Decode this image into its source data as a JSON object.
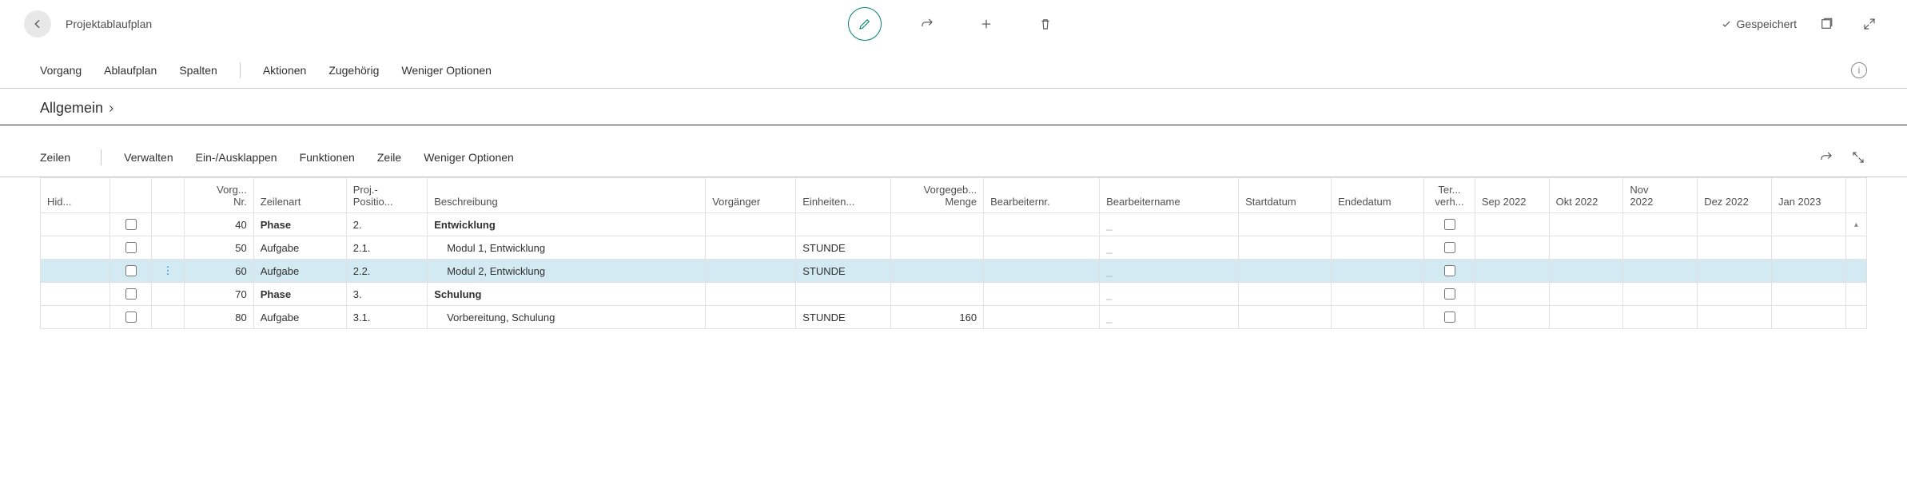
{
  "header": {
    "title": "Projektablaufplan",
    "saved_label": "Gespeichert"
  },
  "menu": {
    "vorgang": "Vorgang",
    "ablaufplan": "Ablaufplan",
    "spalten": "Spalten",
    "aktionen": "Aktionen",
    "zugehoerig": "Zugehörig",
    "weniger_optionen": "Weniger Optionen"
  },
  "section": {
    "title": "Allgemein"
  },
  "lines": {
    "title": "Zeilen",
    "verwalten": "Verwalten",
    "einausklappen": "Ein-/Ausklappen",
    "funktionen": "Funktionen",
    "zeile": "Zeile",
    "weniger_optionen": "Weniger Optionen"
  },
  "columns": {
    "hid": "Hid...",
    "vorg_nr_top": "Vorg...",
    "vorg_nr_bot": "Nr.",
    "zeilenart": "Zeilenart",
    "projpos_top": "Proj.-",
    "projpos_bot": "Positio...",
    "beschreibung": "Beschreibung",
    "vorgaenger": "Vorgänger",
    "einheiten": "Einheiten...",
    "vorgegeb_top": "Vorgegeb...",
    "vorgegeb_bot": "Menge",
    "bearbeiternr": "Bearbeiternr.",
    "bearbeitername": "Bearbeitername",
    "startdatum": "Startdatum",
    "endedatum": "Endedatum",
    "terverh_top": "Ter...",
    "terverh_bot": "verh...",
    "sep2022": "Sep 2022",
    "okt2022": "Okt 2022",
    "nov2022_top": "Nov",
    "nov2022_bot": "2022",
    "dez2022": "Dez 2022",
    "jan2023": "Jan 2023"
  },
  "rows": [
    {
      "vorg_nr": "40",
      "zeilenart": "Phase",
      "zeilenart_bold": true,
      "projpos": "2.",
      "beschreibung": "Entwicklung",
      "besch_bold": true,
      "indent": 0,
      "einheit": "",
      "menge": "",
      "bname": "_",
      "selected": false
    },
    {
      "vorg_nr": "50",
      "zeilenart": "Aufgabe",
      "zeilenart_bold": false,
      "projpos": "2.1.",
      "beschreibung": "Modul 1, Entwicklung",
      "besch_bold": false,
      "indent": 1,
      "einheit": "STUNDE",
      "menge": "",
      "bname": "_",
      "selected": false
    },
    {
      "vorg_nr": "60",
      "zeilenart": "Aufgabe",
      "zeilenart_bold": false,
      "projpos": "2.2.",
      "beschreibung": "Modul 2, Entwicklung",
      "besch_bold": false,
      "indent": 1,
      "einheit": "STUNDE",
      "menge": "",
      "bname": "_",
      "selected": true
    },
    {
      "vorg_nr": "70",
      "zeilenart": "Phase",
      "zeilenart_bold": true,
      "projpos": "3.",
      "beschreibung": "Schulung",
      "besch_bold": true,
      "indent": 0,
      "einheit": "",
      "menge": "",
      "bname": "_",
      "selected": false
    },
    {
      "vorg_nr": "80",
      "zeilenart": "Aufgabe",
      "zeilenart_bold": false,
      "projpos": "3.1.",
      "beschreibung": "Vorbereitung, Schulung",
      "besch_bold": false,
      "indent": 1,
      "einheit": "STUNDE",
      "menge": "160",
      "bname": "_",
      "selected": false
    }
  ]
}
